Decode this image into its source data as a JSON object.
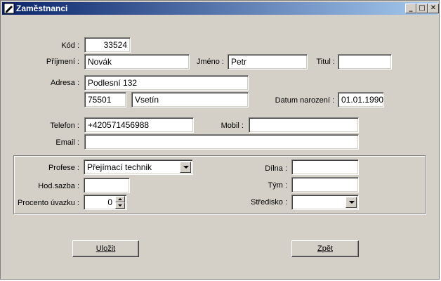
{
  "window": {
    "title": "Zaměstnanci",
    "min": "_",
    "max": "□",
    "close": "✕"
  },
  "form": {
    "kod_label": "Kód :",
    "kod_value": "33524",
    "prijmeni_label": "Příjmení :",
    "prijmeni_value": "Novák",
    "jmeno_label": "Jméno :",
    "jmeno_value": "Petr",
    "titul_label": "Titul :",
    "titul_value": "",
    "adresa_label": "Adresa :",
    "adresa_street": "Podlesní 132",
    "adresa_zip": "75501",
    "adresa_city": "Vsetín",
    "datum_label": "Datum narození :",
    "datum_value": "01.01.1990",
    "telefon_label": "Telefon :",
    "telefon_value": "+420571456988",
    "mobil_label": "Mobil :",
    "mobil_value": "",
    "email_label": "Email :",
    "email_value": ""
  },
  "work": {
    "profese_label": "Profese :",
    "profese_value": "Přejímací technik",
    "hodsazba_label": "Hod.sazba :",
    "hodsazba_value": "",
    "procento_label": "Procento úvazku :",
    "procento_value": "0",
    "dilna_label": "Dílna :",
    "dilna_value": "",
    "tym_label": "Tým :",
    "tym_value": "",
    "stredisko_label": "Středisko :",
    "stredisko_value": ""
  },
  "buttons": {
    "save": "Uložit",
    "back": "Zpět"
  }
}
